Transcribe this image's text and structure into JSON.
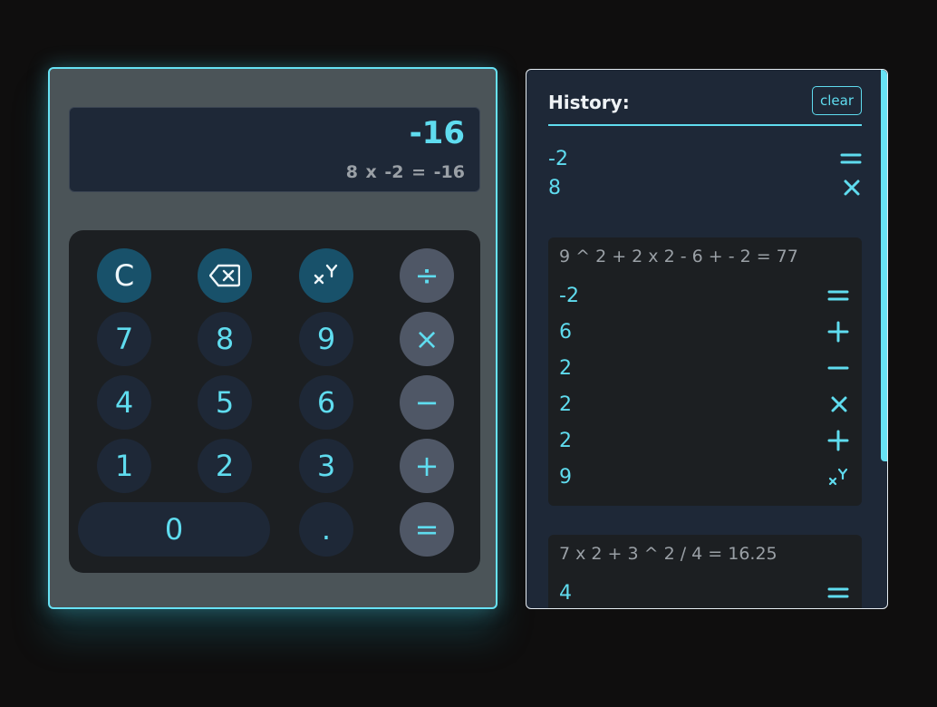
{
  "display": {
    "result": "-16",
    "expression": "8 x -2 = -16"
  },
  "keys": {
    "clear": "C",
    "backspace_icon": "backspace-icon",
    "power_icon": "power-xy-icon",
    "divide": "÷",
    "seven": "7",
    "eight": "8",
    "nine": "9",
    "multiply": "×",
    "four": "4",
    "five": "5",
    "six": "6",
    "minus": "−",
    "one": "1",
    "two": "2",
    "three": "3",
    "plus": "+",
    "zero": "0",
    "dot": ".",
    "equals": "="
  },
  "history": {
    "title": "History:",
    "clear_label": "clear",
    "current": [
      {
        "value": "-2",
        "op": "equals"
      },
      {
        "value": "8",
        "op": "multiply"
      }
    ],
    "entries": [
      {
        "expression": "9 ^ 2 + 2 x 2 - 6 + - 2 = 77",
        "rows": [
          {
            "value": "-2",
            "op": "equals"
          },
          {
            "value": "6",
            "op": "plus"
          },
          {
            "value": "2",
            "op": "minus"
          },
          {
            "value": "2",
            "op": "multiply"
          },
          {
            "value": "2",
            "op": "plus"
          },
          {
            "value": "9",
            "op": "power"
          }
        ]
      },
      {
        "expression": "7 x 2 + 3 ^ 2 / 4 = 16.25",
        "rows": [
          {
            "value": "4",
            "op": "equals"
          }
        ]
      }
    ]
  },
  "colors": {
    "accent": "#5fdcef",
    "panel": "#1e2837",
    "calc_body": "#4b5458",
    "keypad": "#1c1f22",
    "fn_key": "#18516a",
    "op_key": "#4f5766",
    "muted_text": "#9aa0a6"
  }
}
